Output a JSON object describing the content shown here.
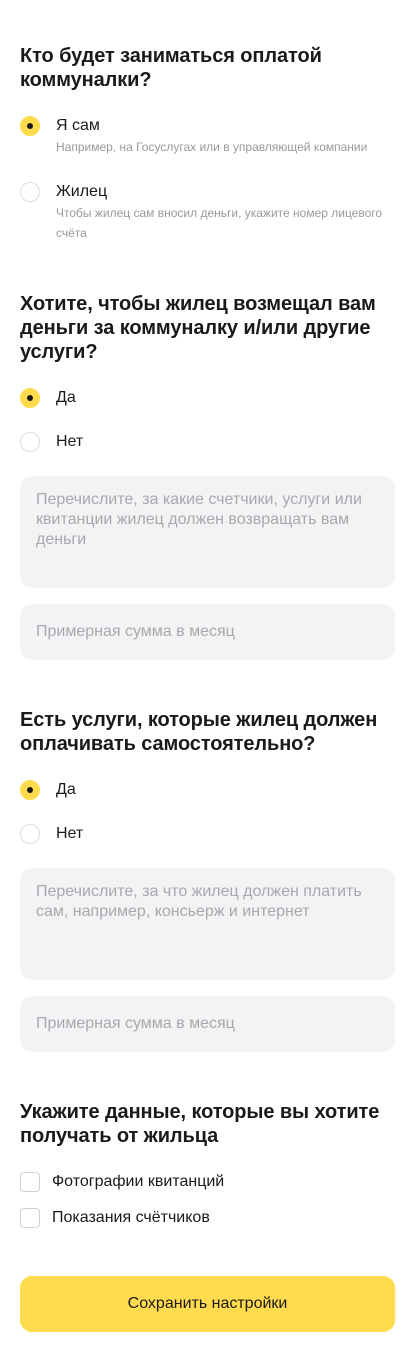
{
  "payer": {
    "title": "Кто будет заниматься оплатой коммуналки?",
    "options": [
      {
        "label": "Я сам",
        "hint": "Например, на Госуслугах или в управляющей компании",
        "selected": true
      },
      {
        "label": "Жилец",
        "hint": "Чтобы жилец сам вносил деньги, укажите номер лицевого счёта",
        "selected": false
      }
    ]
  },
  "reimburse": {
    "title": "Хотите, чтобы жилец возмещал вам деньги за коммуналку и/или другие услуги?",
    "options": [
      {
        "label": "Да",
        "selected": true
      },
      {
        "label": "Нет",
        "selected": false
      }
    ],
    "details_placeholder": "Перечислите, за какие счетчики, услуги или квитанции жилец должен возвращать вам деньги",
    "amount_placeholder": "Примерная сумма в месяц"
  },
  "self_pay": {
    "title": "Есть услуги, которые жилец должен оплачивать самостоятельно?",
    "options": [
      {
        "label": "Да",
        "selected": true
      },
      {
        "label": "Нет",
        "selected": false
      }
    ],
    "details_placeholder": "Перечислите, за что жилец должен платить сам, например, консьерж и интернет",
    "amount_placeholder": "Примерная сумма в месяц"
  },
  "data_request": {
    "title": "Укажите данные, которые вы хотите получать от жильца",
    "checkboxes": [
      {
        "label": "Фотографии квитанций",
        "checked": false
      },
      {
        "label": "Показания счётчиков",
        "checked": false
      }
    ]
  },
  "actions": {
    "save_label": "Сохранить настройки"
  },
  "colors": {
    "accent": "#ffdb4d",
    "field_bg": "#f3f3f5",
    "hint_text": "#999999"
  }
}
